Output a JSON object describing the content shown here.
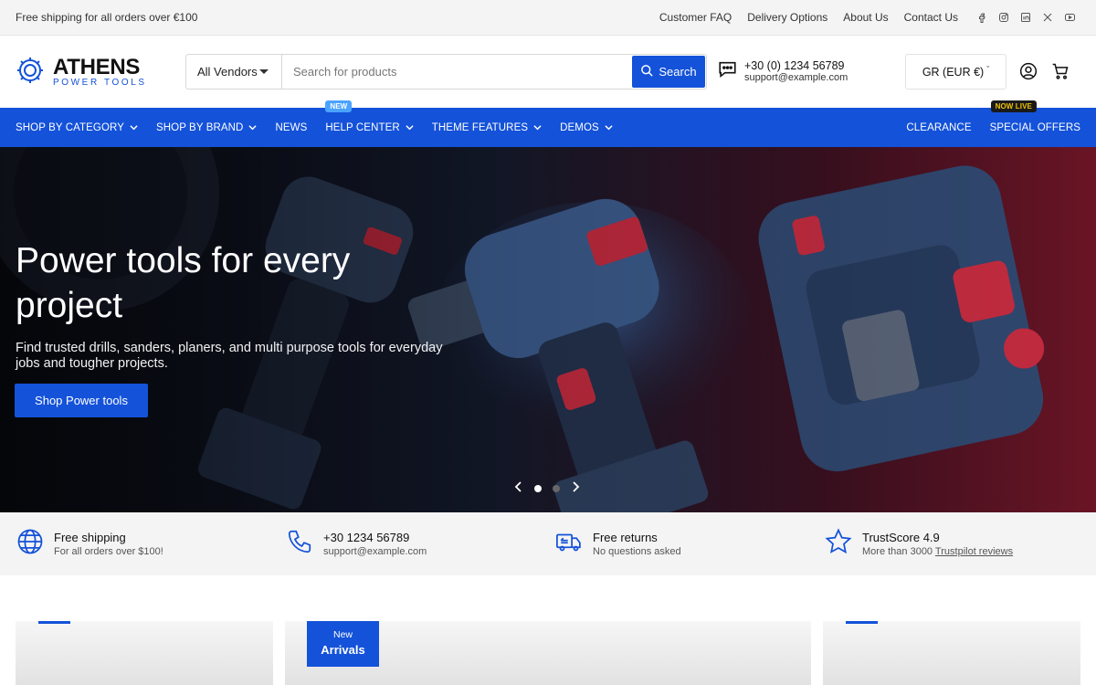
{
  "topbar": {
    "promo": "Free shipping for all orders over €100",
    "links": [
      "Customer FAQ",
      "Delivery Options",
      "About Us",
      "Contact Us"
    ],
    "socials": [
      "facebook-icon",
      "instagram-icon",
      "linkedin-icon",
      "x-icon",
      "youtube-icon"
    ]
  },
  "header": {
    "logo_name": "ATHENS",
    "logo_sub": "POWER TOOLS",
    "vendor_select": "All Vendors",
    "search_placeholder": "Search for products",
    "search_button": "Search",
    "phone": "+30 (0) 1234 56789",
    "email": "support@example.com",
    "currency": "GR (EUR €)"
  },
  "nav": {
    "items": [
      "SHOP BY CATEGORY",
      "SHOP BY BRAND",
      "NEWS",
      "HELP CENTER",
      "THEME FEATURES",
      "DEMOS"
    ],
    "new_badge": "NEW",
    "right_items": [
      "CLEARANCE",
      "SPECIAL OFFERS"
    ],
    "live_badge": "NOW LIVE"
  },
  "hero": {
    "title": "Power tools for every project",
    "subtitle": "Find trusted drills, sanders, planers, and multi purpose tools for everyday jobs and tougher projects.",
    "button": "Shop Power tools",
    "slide_index": 1,
    "slide_count": 2
  },
  "features": [
    {
      "title": "Free shipping",
      "sub": "For all orders over $100!",
      "icon": "globe-icon"
    },
    {
      "title": "+30 1234 56789",
      "sub": "support@example.com",
      "icon": "phone-icon"
    },
    {
      "title": "Free returns",
      "sub": "No questions asked",
      "icon": "truck-return-icon"
    },
    {
      "title": "TrustScore 4.9",
      "sub_prefix": "More than 3000 ",
      "sub_link": "Trustpilot reviews",
      "icon": "star-icon"
    }
  ],
  "cards": {
    "new_tag_line1": "New",
    "new_tag_line2": "Arrivals"
  },
  "colors": {
    "brand": "#1452d9",
    "topbar_bg": "#f4f4f4",
    "badge_new": "#4aa3ff",
    "badge_live_text": "#f2c200"
  }
}
